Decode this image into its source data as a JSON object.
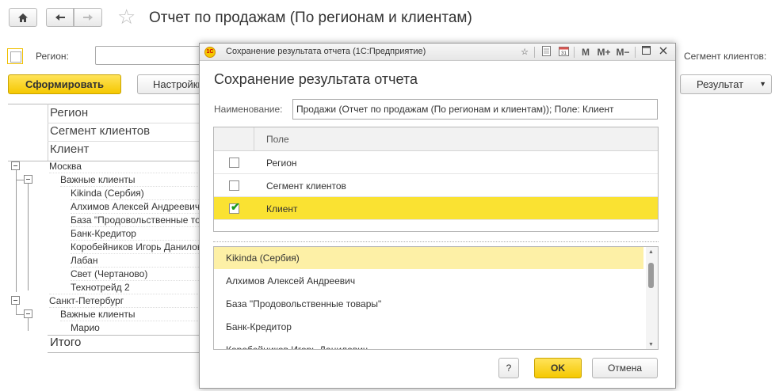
{
  "page": {
    "title": "Отчет по продажам (По регионам и клиентам)",
    "filter_region_label": "Регион:",
    "filter_segment_label": "Сегмент клиентов:",
    "generate_button": "Сформировать",
    "settings_button": "Настройки...",
    "result_button": "Результат"
  },
  "report": {
    "header": [
      "Регион",
      "Сегмент клиентов",
      "Клиент"
    ],
    "rows": [
      {
        "text": "Москва"
      },
      {
        "text": "Важные клиенты"
      },
      {
        "text": "Kikinda (Сербия)"
      },
      {
        "text": "Алхимов Алексей Андреевич"
      },
      {
        "text": "База \"Продовольственные товары\""
      },
      {
        "text": "Банк-Кредитор"
      },
      {
        "text": "Коробейников Игорь Данилович"
      },
      {
        "text": "Лабан"
      },
      {
        "text": "Свет (Чертаново)"
      },
      {
        "text": "Технотрейд 2"
      },
      {
        "text": "Санкт-Петербург"
      },
      {
        "text": "Важные клиенты"
      },
      {
        "text": "Марио"
      }
    ],
    "total_label": "Итого"
  },
  "dialog": {
    "window_title": "Сохранение результата отчета  (1С:Предприятие)",
    "logo_text": "1С",
    "toolbar_m": "M",
    "toolbar_m_plus": "M+",
    "toolbar_m_minus": "M−",
    "heading": "Сохранение результата отчета",
    "name_label": "Наименование:",
    "name_value": "Продажи (Отчет по продажам (По регионам и клиентам)); Поле: Клиент",
    "fields_header": "Поле",
    "fields": [
      {
        "label": "Регион",
        "checked": false
      },
      {
        "label": "Сегмент клиентов",
        "checked": false
      },
      {
        "label": "Клиент",
        "checked": true
      }
    ],
    "values": [
      "Kikinda (Сербия)",
      "Алхимов Алексей Андреевич",
      "База \"Продовольственные товары\"",
      "Банк-Кредитор",
      "Коробейников Игорь Данилович"
    ],
    "help_button": "?",
    "ok_button": "OK",
    "cancel_button": "Отмена"
  },
  "colors": {
    "accent_yellow": "#f5c800",
    "selected_row": "#fae232",
    "selected_list_item": "#fdf0a6"
  }
}
